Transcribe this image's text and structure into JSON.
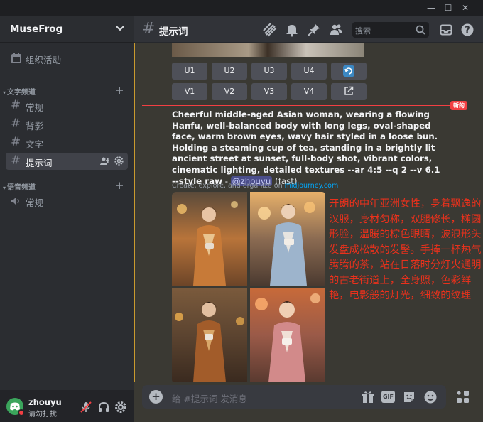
{
  "window": {
    "min": "—",
    "max": "☐",
    "close": "✕"
  },
  "server": {
    "name": "MuseFrog"
  },
  "sidebar": {
    "events_label": "组织活动",
    "text_category": "文字频道",
    "voice_category": "语音频道",
    "text_channels": [
      "常规",
      "背影",
      "文字",
      "提示词"
    ],
    "voice_channels": [
      "常规"
    ]
  },
  "user": {
    "name": "zhouyu",
    "status": "请勿打扰"
  },
  "header": {
    "channel": "提示词",
    "search_placeholder": "搜索"
  },
  "buttons": {
    "upscale": [
      "U1",
      "U2",
      "U3",
      "U4"
    ],
    "variation": [
      "V1",
      "V2",
      "V3",
      "V4"
    ]
  },
  "new_label": "新的",
  "message": {
    "prompt": "Cheerful middle-aged Asian woman, wearing a flowing Hanfu, well-balanced body with long legs, oval-shaped face, warm brown eyes, wavy hair styled in a loose bun. Holding a steaming cup of tea, standing in a brightly lit ancient street at sunset, full-body shot, vibrant colors, cinematic lighting, detailed textures --ar 4:5 --q 2 --v 6.1 --style raw",
    "dash": " - ",
    "mention": "@zhouyu",
    "speed": " (fast)",
    "sub_text": "Create, explore, and organize on ",
    "sub_link": "midjourney.com",
    "translation": "开朗的中年亚洲女性，身着飘逸的汉服，身材匀称，双腿修长，椭圆形脸，温暖的棕色眼睛，波浪形头发盘成松散的发髻。手捧一杯热气腾腾的茶，站在日落时分灯火通明的古老街道上，全身照，色彩鲜艳，电影般的灯光，细致的纹理"
  },
  "composer": {
    "placeholder": "给 #提示词 发消息",
    "gif_label": "GIF"
  },
  "colors": {
    "accent": "#c99a2e",
    "translation": "#e9311c",
    "new_line": "#f23f43",
    "link": "#00a8fc"
  }
}
